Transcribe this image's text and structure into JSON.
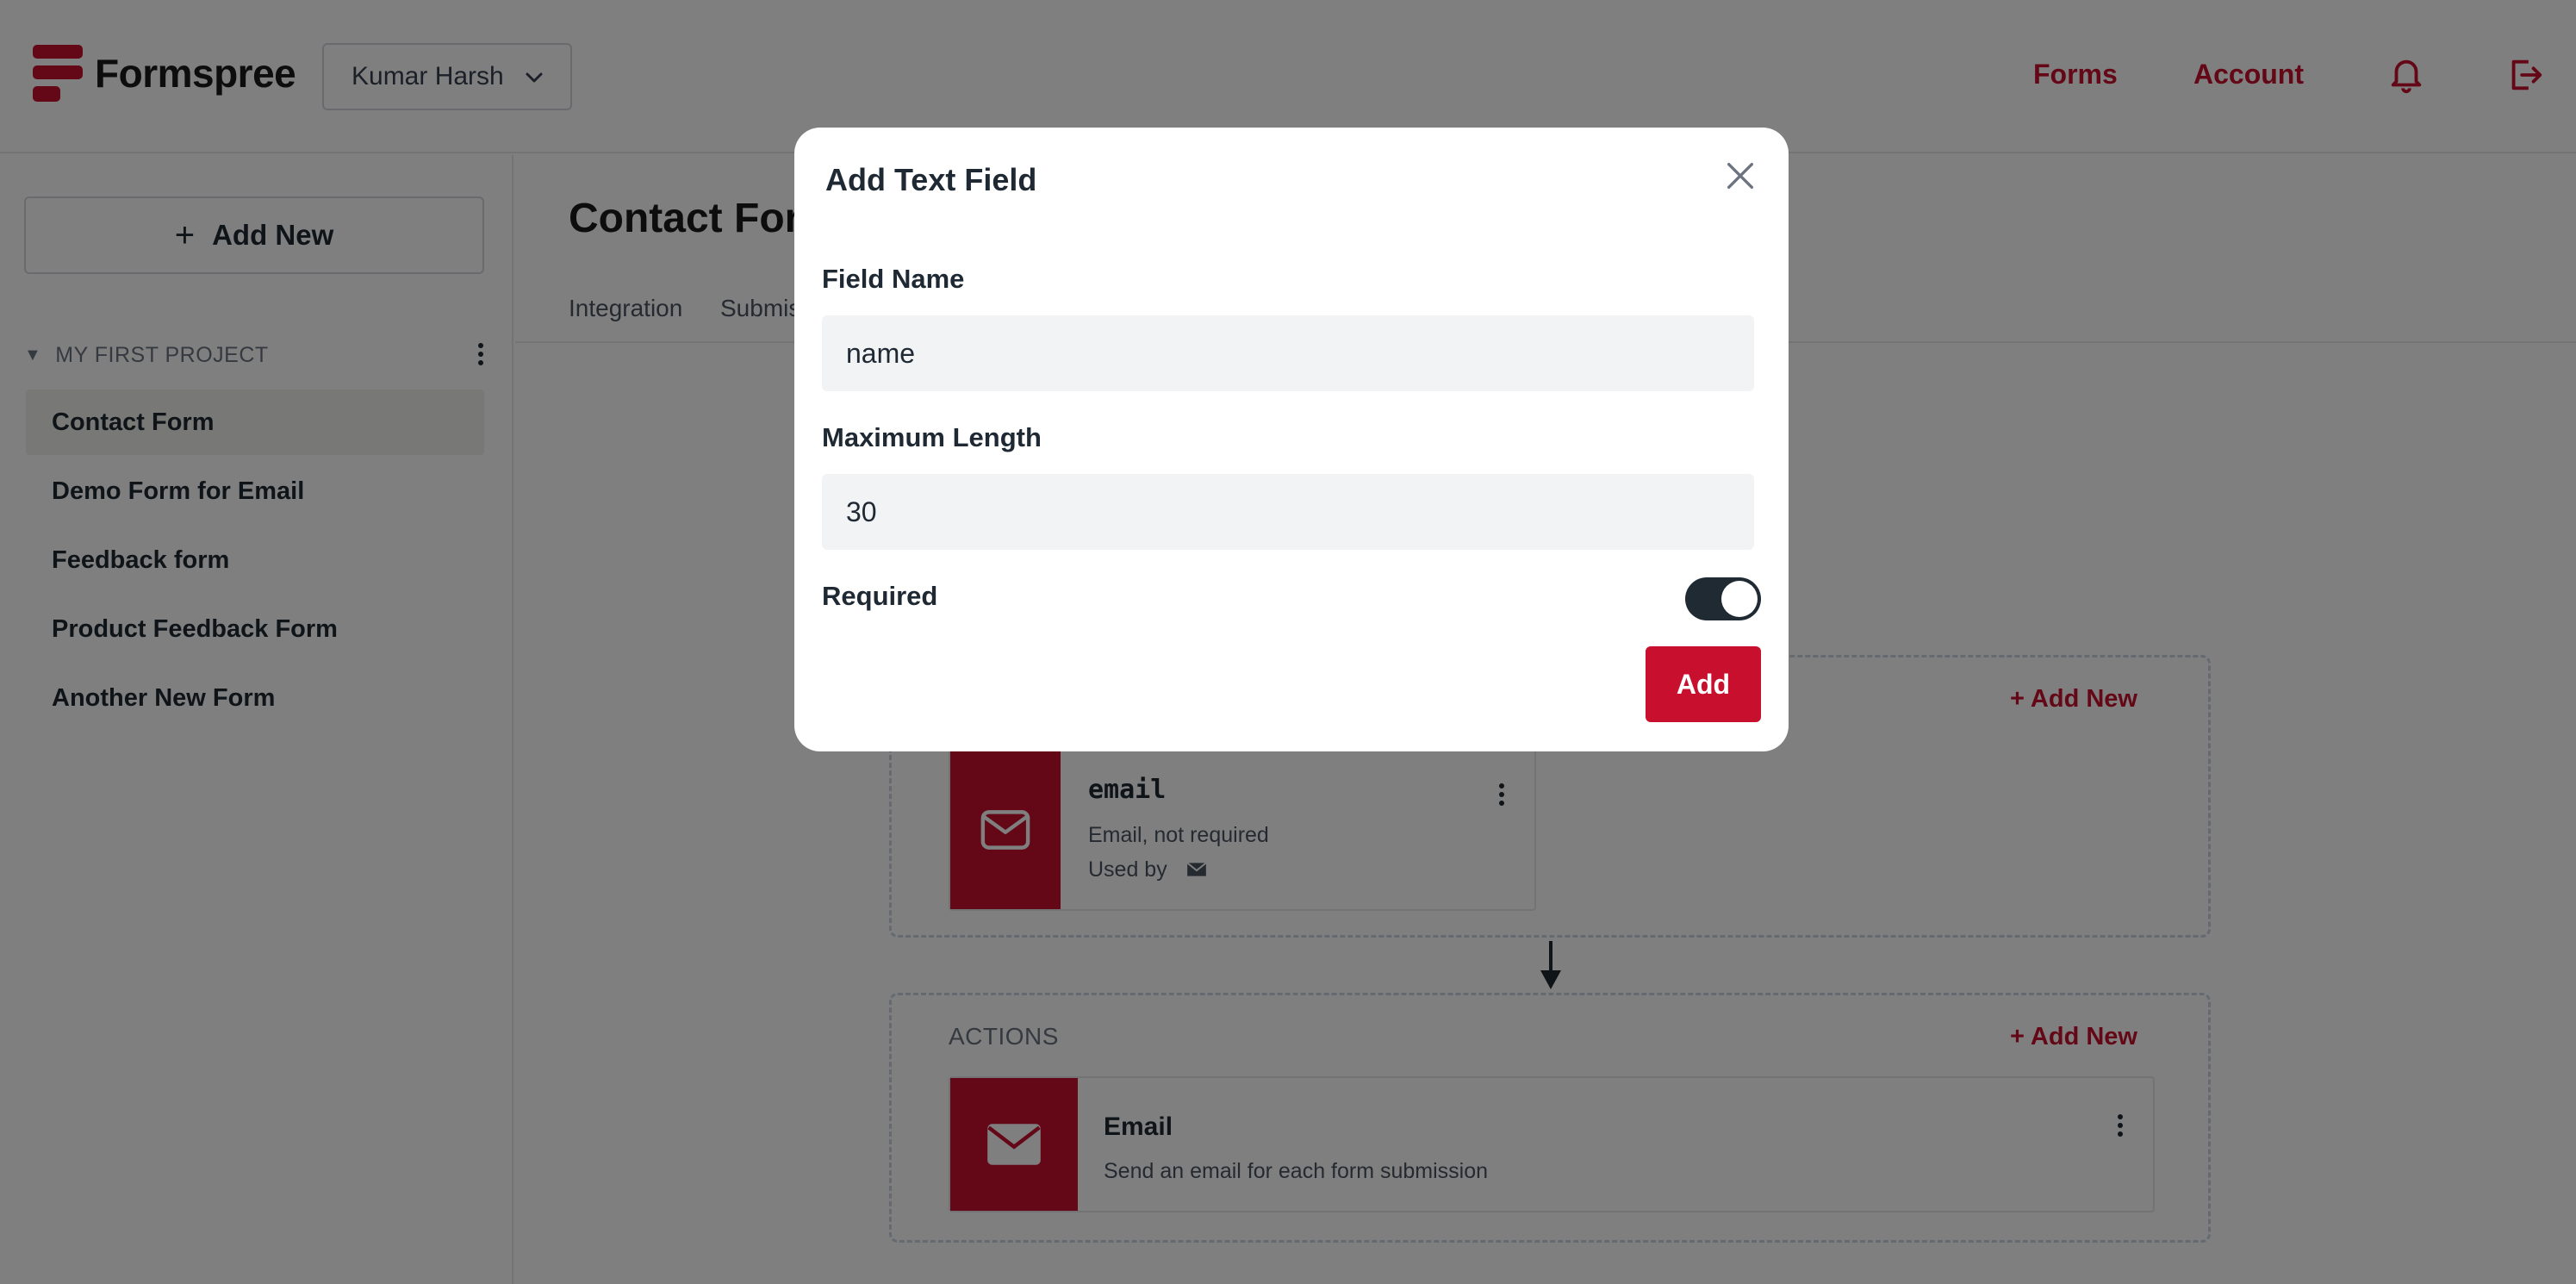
{
  "header": {
    "brand": "Formspree",
    "account_selector": "Kumar Harsh",
    "nav": {
      "forms": "Forms",
      "account": "Account"
    },
    "icons": {
      "notifications": "bell-icon",
      "logout": "logout-icon"
    }
  },
  "sidebar": {
    "add_new": "Add New",
    "project": "MY FIRST PROJECT",
    "items": [
      {
        "label": "Contact Form",
        "active": true
      },
      {
        "label": "Demo Form for Email",
        "active": false
      },
      {
        "label": "Feedback form",
        "active": false
      },
      {
        "label": "Product Feedback Form",
        "active": false
      },
      {
        "label": "Another New Form",
        "active": false
      }
    ]
  },
  "main": {
    "title": "Contact Form",
    "tabs": [
      "Integration",
      "Submissions"
    ],
    "fields_section": {
      "add_new": "+ Add New",
      "card": {
        "title": "email",
        "subtitle": "Email, not required",
        "used_by": "Used by"
      }
    },
    "actions_section": {
      "label": "ACTIONS",
      "add_new": "+ Add New",
      "card": {
        "title": "Email",
        "subtitle": "Send an email for each form submission"
      }
    }
  },
  "modal": {
    "title": "Add Text Field",
    "field_name_label": "Field Name",
    "field_name_value": "name",
    "max_length_label": "Maximum Length",
    "max_length_value": "30",
    "required_label": "Required",
    "required_on": true,
    "submit": "Add"
  },
  "colors": {
    "brand": "#c8102e",
    "toggle_on": "#1f2a33",
    "overlay": "rgba(0,0,0,0.5)"
  }
}
